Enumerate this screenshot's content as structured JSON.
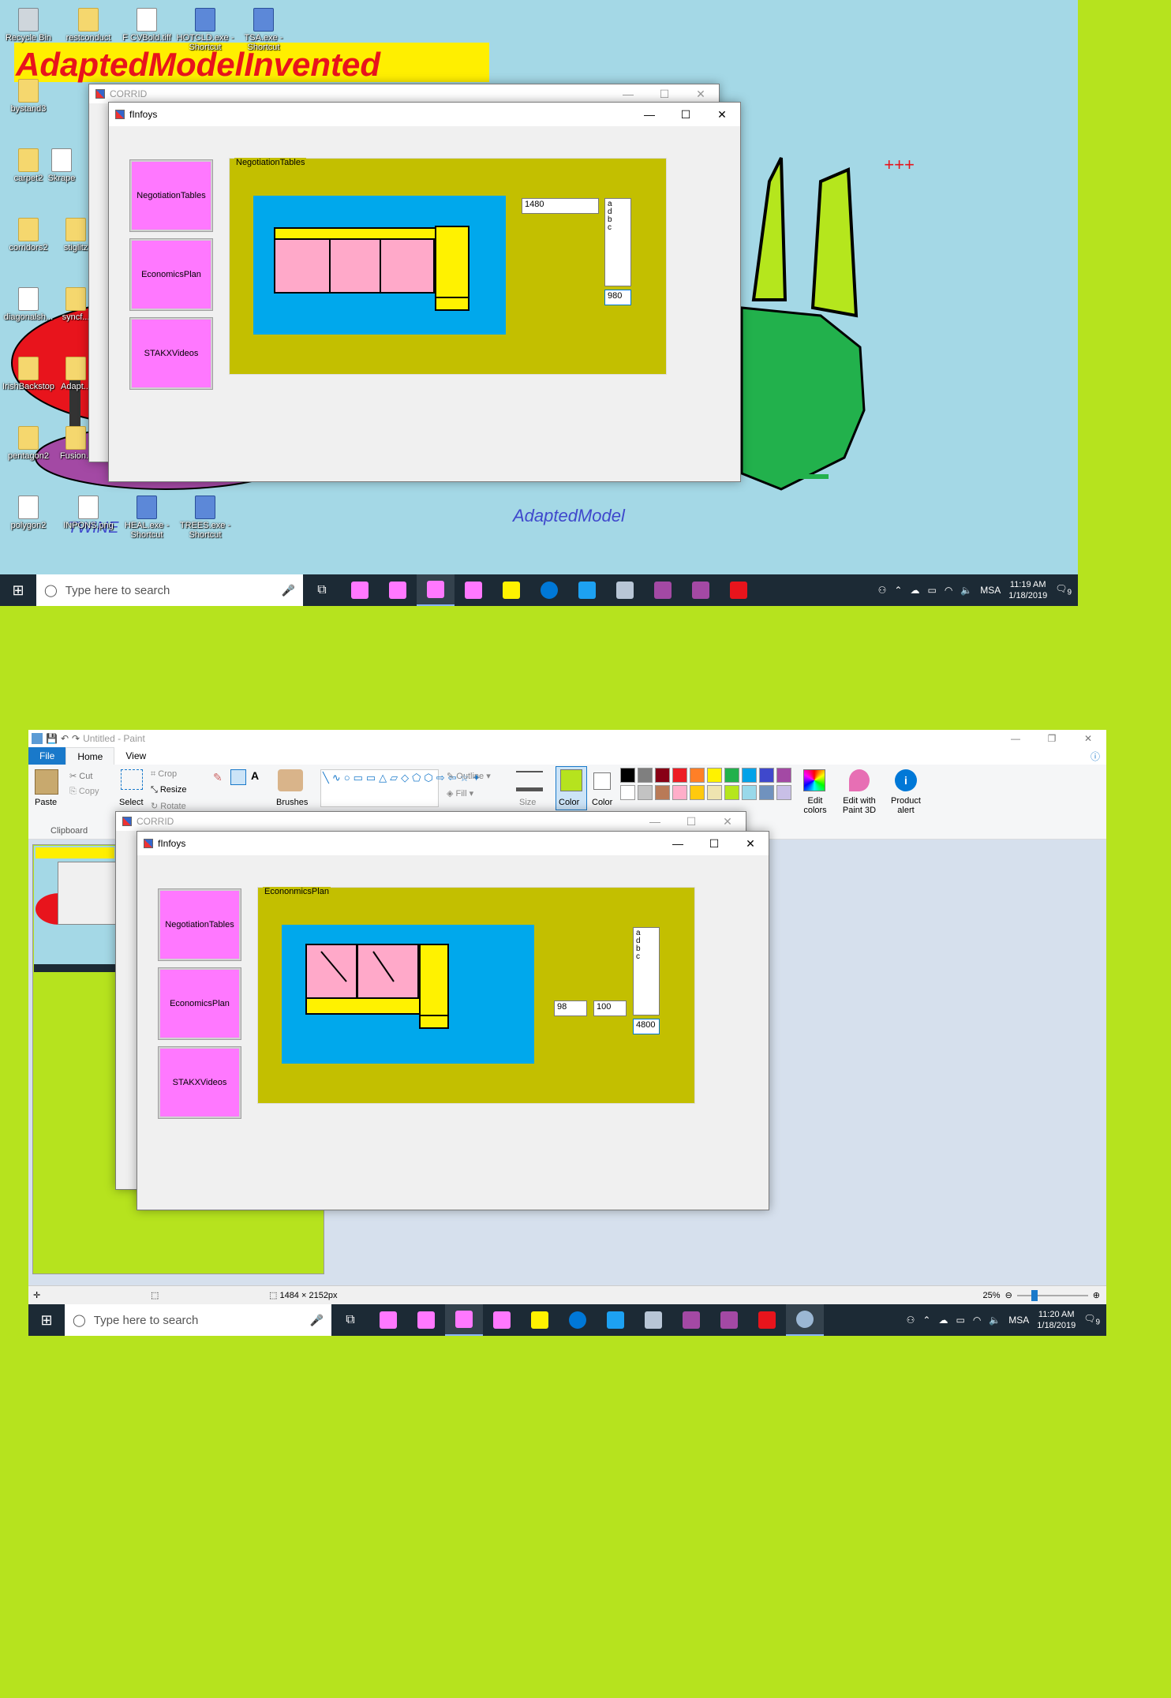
{
  "top_desktop": {
    "banner_text": "AdaptedModelInvented",
    "footer_text": "AdaptedModel",
    "plus_marks": "+++",
    "watermark_text": "TWINE",
    "icons": [
      {
        "label": "Recycle Bin",
        "kind": "recycle"
      },
      {
        "label": "restconduct",
        "kind": "folder"
      },
      {
        "label": "F CVBold.tiff",
        "kind": "file"
      },
      {
        "label": "HOTCLD.exe - Shortcut",
        "kind": "exe"
      },
      {
        "label": "TSA.exe - Shortcut",
        "kind": "exe"
      },
      {
        "label": "bystand3",
        "kind": "folder"
      },
      {
        "label": "carpet2",
        "kind": "folder"
      },
      {
        "label": "Skrape",
        "kind": "file"
      },
      {
        "label": "corridors2",
        "kind": "folder"
      },
      {
        "label": "stiglitz",
        "kind": "folder"
      },
      {
        "label": "diagonalsh...",
        "kind": "file"
      },
      {
        "label": "syncf...",
        "kind": "folder"
      },
      {
        "label": "IrishBackstop",
        "kind": "folder"
      },
      {
        "label": "Adapt...",
        "kind": "folder"
      },
      {
        "label": "pentagon2",
        "kind": "folder"
      },
      {
        "label": "Fusion...",
        "kind": "folder"
      },
      {
        "label": "polygon2",
        "kind": "file"
      },
      {
        "label": "INPONS.png",
        "kind": "file"
      },
      {
        "label": "HEAL.exe - Shortcut",
        "kind": "exe"
      },
      {
        "label": "TREES.exe - Shortcut",
        "kind": "exe"
      }
    ]
  },
  "top_app": {
    "corrid_title": "CORRID",
    "form_title": "fInfoys",
    "nav_buttons": [
      "NegotiationTables",
      "EconomicsPlan",
      "STAKXVideos"
    ],
    "group_label": "NegotiationTables",
    "text_box": "1480",
    "list_items": [
      "a",
      "d",
      "b",
      "c"
    ],
    "list_value": "980"
  },
  "taskbar_top": {
    "search_placeholder": "Type here to search",
    "time": "11:19 AM",
    "date": "1/18/2019",
    "lang": "MSA",
    "notif": "9"
  },
  "paint": {
    "title": "Untitled - Paint",
    "tabs": [
      "File",
      "Home",
      "View"
    ],
    "clipboard": {
      "paste": "Paste",
      "cut": "Cut",
      "copy": "Copy",
      "label": "Clipboard"
    },
    "image": {
      "select": "Select",
      "crop": "Crop",
      "resize": "Resize",
      "rotate": "Rotate"
    },
    "brushes": "Brushes",
    "outline": "Outline",
    "fill": "Fill",
    "size": "Size",
    "color1": "Color",
    "color2": "Color",
    "edit_colors": "Edit colors",
    "edit_3d": "Edit with Paint 3D",
    "product_alert": "Product alert",
    "palette": [
      "#000000",
      "#7f7f7f",
      "#880015",
      "#ed1c24",
      "#ff7f27",
      "#fff200",
      "#22b14c",
      "#00a2e8",
      "#3f48cc",
      "#a349a4",
      "#ffffff",
      "#c3c3c3",
      "#b97a57",
      "#ffaec9",
      "#ffc90e",
      "#efe4b0",
      "#b5e61d",
      "#99d9ea",
      "#7092be",
      "#c8bfe7"
    ],
    "color1_value": "#b6e31e",
    "status_dims": "1484 × 2152px",
    "zoom": "25%"
  },
  "bottom_app": {
    "corrid_title": "CORRID",
    "form_title": "fInfoys",
    "nav_buttons": [
      "NegotiationTables",
      "EconomicsPlan",
      "STAKXVideos"
    ],
    "group_label": "EcononmicsPlan",
    "text_box_a": "98",
    "text_box_b": "100",
    "list_items": [
      "a",
      "d",
      "b",
      "c"
    ],
    "list_value": "4800"
  },
  "taskbar_bottom": {
    "search_placeholder": "Type here to search",
    "time": "11:20 AM",
    "date": "1/18/2019",
    "lang": "MSA",
    "notif": "9"
  }
}
